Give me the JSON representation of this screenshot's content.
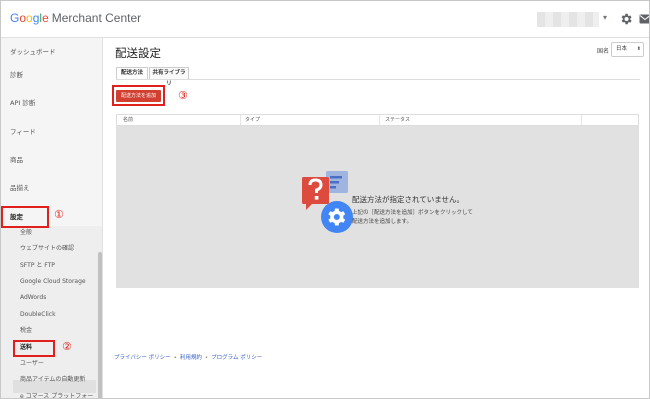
{
  "header": {
    "logo_google": [
      "G",
      "o",
      "o",
      "g",
      "l",
      "e"
    ],
    "logo_product": "Merchant Center",
    "account_caret": "▾"
  },
  "sidebar": {
    "items": [
      {
        "label": "ダッシュボード"
      },
      {
        "label": "診断"
      },
      {
        "label": "API 診断"
      },
      {
        "label": "フィード"
      },
      {
        "label": "商品"
      },
      {
        "label": "品揃え"
      },
      {
        "label": "設定"
      }
    ],
    "sub_items": [
      {
        "label": "全般"
      },
      {
        "label": "ウェブサイトの確認"
      },
      {
        "label": "SFTP と FTP"
      },
      {
        "label": "Google Cloud Storage"
      },
      {
        "label": "AdWords"
      },
      {
        "label": "DoubleClick"
      },
      {
        "label": "税金"
      },
      {
        "label": "送料"
      },
      {
        "label": "ユーザー"
      },
      {
        "label": "商品アイテムの自動更新"
      },
      {
        "label": "e コマース プラットフォー"
      }
    ]
  },
  "main": {
    "title": "配送設定",
    "country_label": "国名",
    "country_value": "日本",
    "country_arrow": "⬍",
    "tabs": [
      {
        "label": "配送方法",
        "active": true
      },
      {
        "label": "共有ライブラリ",
        "active": false
      }
    ],
    "add_button": "配送方法を追加",
    "table_columns": [
      "名前",
      "タイプ",
      "ステータス"
    ],
    "empty_title": "配送方法が指定されていません。",
    "empty_desc_line1": "上記の［配送方法を追加］ボタンをクリックして",
    "empty_desc_line2": "配送方法を追加します。"
  },
  "footer": {
    "links": [
      "プライバシー ポリシー",
      "利用規約",
      "プログラム ポリシー"
    ],
    "separator": "•"
  },
  "annotations": {
    "marker1": "①",
    "marker2": "②",
    "marker3": "③"
  },
  "colors": {
    "accent_red": "#d23f31",
    "highlight_red": "#e0201c",
    "link_blue": "#3b62c8",
    "google_blue": "#4285f4"
  }
}
